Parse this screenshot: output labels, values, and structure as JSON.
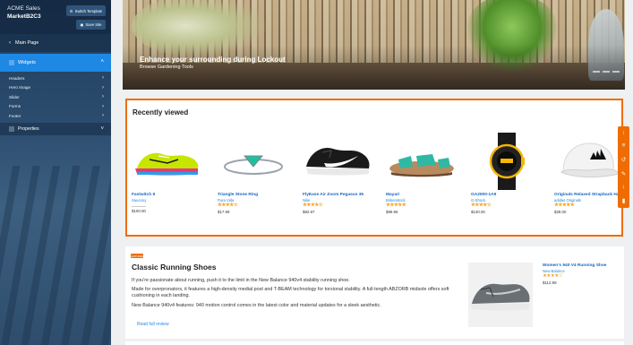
{
  "sidebar": {
    "app_title": "ACME Sales",
    "site_name": "MarketB2C3",
    "switch_template_label": "Switch Template",
    "save_site_label": "Save Site",
    "main_page_label": "Main Page",
    "widgets_label": "Widgets",
    "widget_items": [
      {
        "label": "Headers"
      },
      {
        "label": "Hero Image"
      },
      {
        "label": "Slider"
      },
      {
        "label": "Forms"
      },
      {
        "label": "Footer"
      }
    ],
    "properties_label": "Properties"
  },
  "hero": {
    "title": "Enhance your surrounding during Lockout",
    "subtitle": "Browse Gardening Tools"
  },
  "recently_viewed": {
    "title": "Recently viewed",
    "products": [
      {
        "name": "Fastwitch 9",
        "brand": "Saucony",
        "stars": "",
        "price": "$100.00"
      },
      {
        "name": "Triangle Stone Ring",
        "brand": "Pura Vida",
        "stars": "★★★★☆",
        "price": "$17.99"
      },
      {
        "name": "FlyEase Air Zoom Pegasus 35",
        "brand": "Nike",
        "stars": "★★★★☆",
        "price": "$82.97"
      },
      {
        "name": "Mayari",
        "brand": "Birkenstock",
        "stars": "★★★★★",
        "price": "$99.95"
      },
      {
        "name": "GA2000-1A9",
        "brand": "G-Shock",
        "stars": "★★★★☆",
        "price": "$130.00"
      },
      {
        "name": "Originals Relaxed Strapback Hat",
        "brand": "adidas Originals",
        "stars": "★★★★★",
        "price": "$28.00"
      }
    ]
  },
  "article": {
    "badge": "FEATURED",
    "title": "Classic Running Shoes",
    "p1": "If you're passionate about running, push it to the limit in the New Balance 940v4 stability running shoe.",
    "p2": "Made for overpronators, it features a high-density medial post and T-BEAM technology for torsional stability. A full-length ABZORB midsole offers soft cushioning in each landing.",
    "p3": "New Balance 940v4 features: 940 motion control comes in the latest color and material updates for a sleek aesthetic.",
    "link": "Read full review",
    "product": {
      "name": "Women's 940 V4 Running Shoe",
      "brand": "New Balance",
      "stars": "★★★★☆",
      "price": "$112.99"
    }
  },
  "toolbar_icons": [
    "arrow-up-icon",
    "menu-icon",
    "history-icon",
    "edit-icon",
    "arrow-down-icon",
    "delete-icon"
  ],
  "colors": {
    "accent": "#ef6c00",
    "primary": "#1e88e5",
    "sidebar": "#2b4c6e",
    "star": "#f5a623"
  }
}
